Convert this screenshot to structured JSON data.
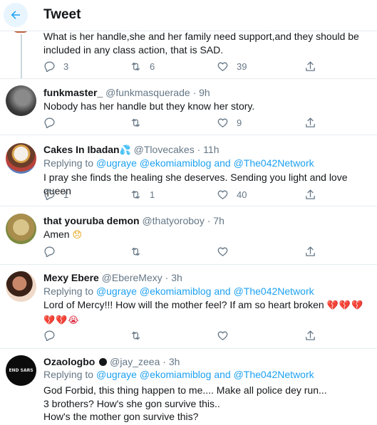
{
  "header": {
    "title": "Tweet"
  },
  "tweets": [
    {
      "text": "What is her handle,she and her family need support,and they should be included in any class action, that is SAD.",
      "reply_count": "3",
      "retweet_count": "6",
      "like_count": "39"
    },
    {
      "name": "funkmaster_",
      "handle": "@funkmasquerade",
      "dot": "·",
      "time": "9h",
      "text": "Nobody has her handle but they know her story.",
      "reply_count": "",
      "retweet_count": "",
      "like_count": "9"
    },
    {
      "name": "Cakes In Ibadan",
      "name_emoji": "💦",
      "handle": "@Tlovecakes",
      "dot": "·",
      "time": "11h",
      "replying_prefix": "Replying to",
      "replying_user1": "@ugraye",
      "replying_user2": "@ekomiamiblog",
      "replying_and": "and",
      "replying_user3": "@The042Network",
      "text": "I pray she finds the healing she deserves.  Sending you light and love queen",
      "reply_count": "1",
      "retweet_count": "1",
      "like_count": "40"
    },
    {
      "name": "that youruba demon",
      "handle": "@thatyoroboy",
      "dot": "·",
      "time": "7h",
      "text": "Amen",
      "text_emoji": "😞",
      "reply_count": "",
      "retweet_count": "",
      "like_count": ""
    },
    {
      "name": "Mexy Ebere",
      "handle": "@EbereMexy",
      "dot": "·",
      "time": "3h",
      "replying_prefix": "Replying to",
      "replying_user1": "@ugraye",
      "replying_user2": "@ekomiamiblog",
      "replying_and": "and",
      "replying_user3": "@The042Network",
      "text": "Lord of Mercy!!! How will the mother feel? If am so heart broken",
      "text_emoji": "💔💔💔💔💔😭",
      "reply_count": "",
      "retweet_count": "",
      "like_count": ""
    },
    {
      "name": "Ozaologbo",
      "handle": "@jay_zeea",
      "dot": "·",
      "time": "3h",
      "avatar_text": "END SARS",
      "replying_prefix": "Replying to",
      "replying_user1": "@ugraye",
      "replying_user2": "@ekomiamiblog",
      "replying_and": "and",
      "replying_user3": "@The042Network",
      "text": "God Forbid, this thing happen to me.... Make all police dey run...\n3 brothers? How's she gon survive this..\nHow's the mother gon survive this?"
    }
  ],
  "colors": {
    "accent": "#1da1f2",
    "secondary_text": "#657786",
    "divider": "#e6ecf0"
  },
  "icons": [
    "back-arrow-icon",
    "reply-icon",
    "retweet-icon",
    "like-icon",
    "share-icon",
    "verified-icon"
  ]
}
